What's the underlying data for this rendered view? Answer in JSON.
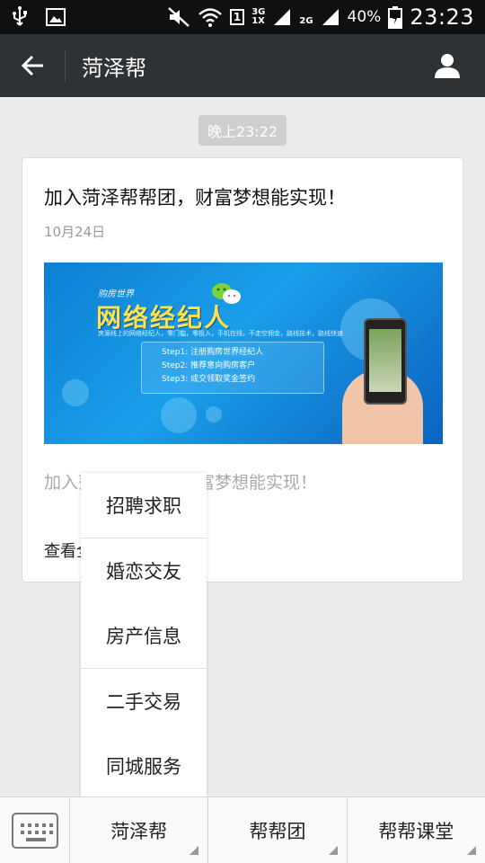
{
  "status_bar": {
    "sim_slot": "1",
    "network_3g": "3G",
    "network_1x": "1X",
    "network_2g": "2G",
    "battery": "40%",
    "time": "23:23"
  },
  "header": {
    "title": "菏泽帮"
  },
  "chat": {
    "timestamp": "晚上23:22"
  },
  "article": {
    "title": "加入菏泽帮帮团，财富梦想能实现！",
    "date": "10月24日",
    "description": "加入菏泽帮帮团，财富梦想能实现！",
    "read_more": "查看全文",
    "cover": {
      "brand": "购房世界",
      "headline": "网络经纪人",
      "subline": "房源线上的网络经纪人，零门槛，零投入，手机在线，不走空佣金，路线技术，路线快速",
      "steps": [
        "Step1: 注册购房世界经纪人",
        "Step2: 推荐意向购房客户",
        "Step3: 成交领取奖金签约"
      ]
    }
  },
  "popup_menu": {
    "items": [
      "招聘求职",
      "婚恋交友",
      "房产信息",
      "二手交易",
      "同城服务"
    ]
  },
  "bottom_bar": {
    "tabs": [
      "菏泽帮",
      "帮帮团",
      "帮帮课堂"
    ]
  }
}
